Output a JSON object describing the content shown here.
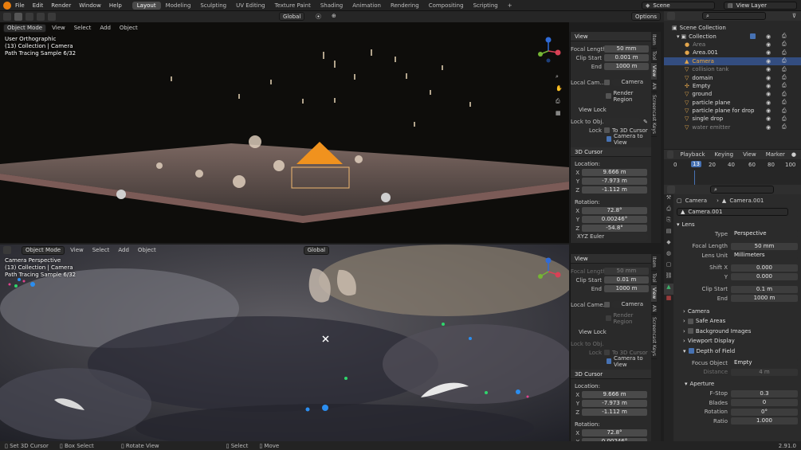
{
  "menu": [
    "File",
    "Edit",
    "Render",
    "Window",
    "Help"
  ],
  "workspaces": [
    "Layout",
    "Modeling",
    "Sculpting",
    "UV Editing",
    "Texture Paint",
    "Shading",
    "Animation",
    "Rendering",
    "Compositing",
    "Scripting"
  ],
  "scene_name": "Scene",
  "view_layer": "View Layer",
  "top_header": {
    "orientation": "Global",
    "options": "Options"
  },
  "vp_top": {
    "mode": "Object Mode",
    "menus": [
      "View",
      "Select",
      "Add",
      "Object"
    ],
    "overlay_lines": [
      "User Orthographic",
      "(13) Collection | Camera",
      "Path Tracing Sample 6/32"
    ]
  },
  "vp_bottom": {
    "mode": "Object Mode",
    "menus": [
      "View",
      "Select",
      "Add",
      "Object"
    ],
    "orientation": "Global",
    "overlay_lines": [
      "Camera Perspective",
      "(13) Collection | Camera",
      "Path Tracing Sample 6/32"
    ]
  },
  "npanel_top": {
    "view_title": "View",
    "focal_label": "Focal Length",
    "focal": "50 mm",
    "clip_start_label": "Clip Start",
    "clip_start": "0.001 m",
    "end_label": "End",
    "end": "1000 m",
    "local_cam_label": "Local Cam...",
    "local_cam": "Camera",
    "render_region": "Render Region",
    "view_lock": "View Lock",
    "lock_obj_label": "Lock to Obj...",
    "lock_label": "Lock",
    "to_cursor": "To 3D Cursor",
    "camera_to_view": "Camera to View",
    "cursor_title": "3D Cursor",
    "location": "Location:",
    "x": "9.666 m",
    "y": "-7.973 m",
    "z": "-1.112 m",
    "rotation": "Rotation:",
    "rx": "72.8°",
    "ry": "0.00246°",
    "rz": "-54.8°",
    "euler": "XYZ Euler"
  },
  "npanel_bottom": {
    "view_title": "View",
    "focal_label": "Focal Length",
    "focal": "50 mm",
    "clip_start_label": "Clip Start",
    "clip_start": "0.01 m",
    "end_label": "End",
    "end": "1000 m",
    "local_cam_label": "Local Came...",
    "local_cam": "Camera",
    "render_region": "Render Region",
    "view_lock": "View Lock",
    "lock_obj_label": "Lock to Obj...",
    "lock_label": "Lock",
    "to_cursor": "To 3D Cursor",
    "camera_to_view": "Camera to View",
    "cursor_title": "3D Cursor",
    "location": "Location:",
    "x": "9.666 m",
    "y": "-7.973 m",
    "z": "-1.112 m",
    "rotation": "Rotation:",
    "rx": "72.8°",
    "ry": "0.00246°"
  },
  "side_tabs": [
    "Item",
    "Tool",
    "View",
    "AN",
    "Screencast Keys"
  ],
  "outliner": {
    "title": "Scene Collection",
    "collection": "Collection",
    "items": [
      "Area",
      "Area.001",
      "Camera",
      "collision tank",
      "domain",
      "Empty",
      "ground",
      "particle plane",
      "particle plane for drop",
      "single drop",
      "water emitter"
    ]
  },
  "timeline": {
    "menus": [
      "Playback",
      "Keying",
      "View",
      "Marker"
    ],
    "frame": "13",
    "ticks": [
      "0",
      "20",
      "40",
      "60",
      "80",
      "100"
    ]
  },
  "properties": {
    "breadcrumb_obj": "Camera",
    "breadcrumb_data": "Camera.001",
    "datablock": "Camera.001",
    "lens_title": "Lens",
    "type_label": "Type",
    "type": "Perspective",
    "focal_label": "Focal Length",
    "focal": "50 mm",
    "lens_unit_label": "Lens Unit",
    "lens_unit": "Millimeters",
    "shift_x_label": "Shift X",
    "shift_x": "0.000",
    "y_label": "Y",
    "shift_y": "0.000",
    "clip_start_label": "Clip Start",
    "clip_start": "0.1 m",
    "end_label": "End",
    "clip_end": "1000 m",
    "camera_sec": "Camera",
    "safe_areas": "Safe Areas",
    "bg_images": "Background Images",
    "viewport_display": "Viewport Display",
    "dof": "Depth of Field",
    "focus_label": "Focus Object",
    "focus": "Empty",
    "distance_label": "Distance",
    "distance": "4 m",
    "aperture": "Aperture",
    "fstop_label": "F-Stop",
    "fstop": "0.3",
    "blades_label": "Blades",
    "blades": "0",
    "rotation_label": "Rotation",
    "rotation": "0°",
    "ratio_label": "Ratio",
    "ratio": "1.000"
  },
  "statusbar": [
    "Set 3D Cursor",
    "Box Select",
    "Rotate View",
    "Select",
    "Move"
  ],
  "version": "2.91.0",
  "colors": {
    "accent": "#4772b3",
    "selected_row": "#334d80",
    "camera_orange": "#f0921e"
  }
}
